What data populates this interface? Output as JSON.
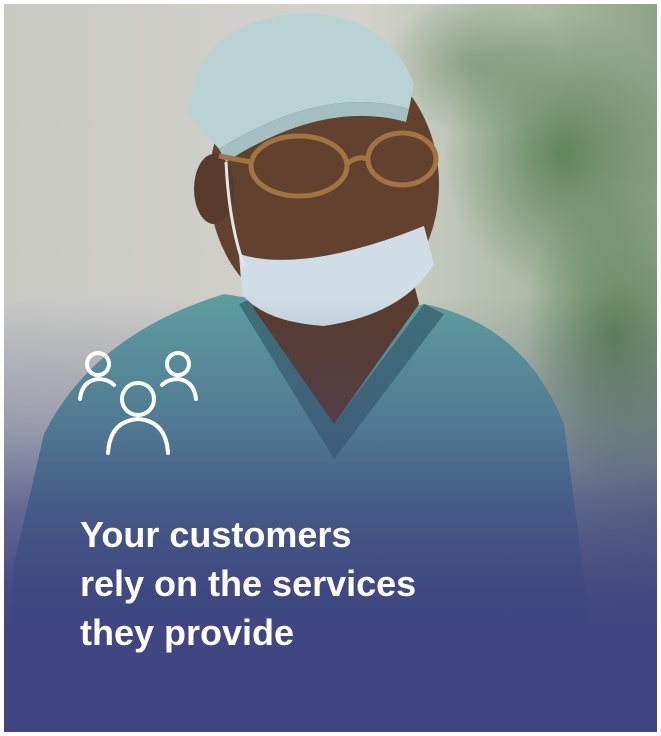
{
  "card": {
    "background_color": "#3f4681",
    "photo_subject": "man wearing surgical cap, glasses and mask under chin, in teal scrubs",
    "icon": "people-group-icon",
    "headline": {
      "line1": "Your customers",
      "line2": "rely on the services",
      "line3": "they provide"
    }
  }
}
